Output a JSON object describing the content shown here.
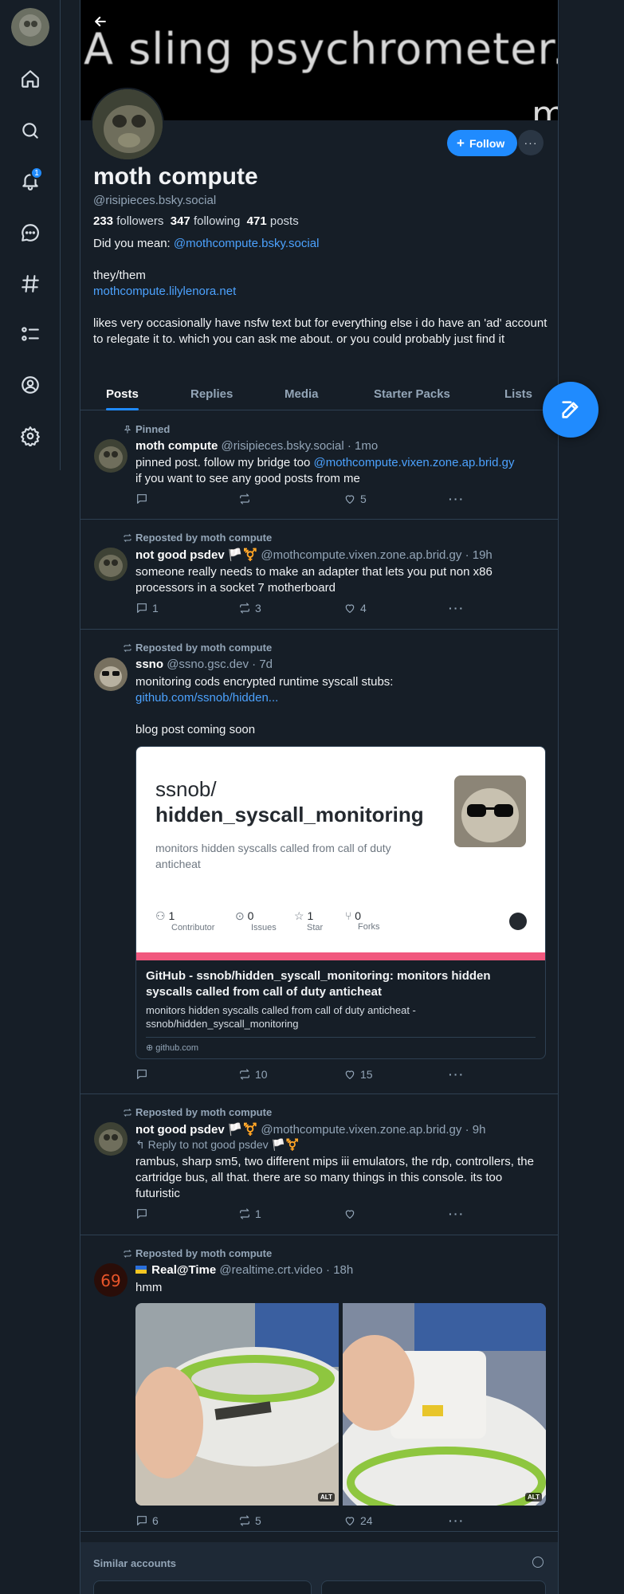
{
  "banner": {
    "text": "A sling psychrometer.",
    "text_fragment": "m"
  },
  "rail": {
    "notifications_count": "1"
  },
  "profile": {
    "display_name": "moth compute",
    "handle": "@risipieces.bsky.social",
    "followers_count": "233",
    "followers_label": "followers",
    "following_count": "347",
    "following_label": "following",
    "posts_count": "471",
    "posts_label": "posts",
    "follow_label": "Follow",
    "bio_did_you_mean": "Did you mean:",
    "bio_did_you_mean_link": "@mothcompute.bsky.social",
    "bio_pronouns": "they/them",
    "bio_site": "mothcompute.lilylenora.net",
    "bio_text": "likes very occasionally have nsfw text but for everything else i do have an 'ad' account to relegate it to. which you can ask me about. or you could probably just find it"
  },
  "tabs": [
    "Posts",
    "Replies",
    "Media",
    "Starter Packs",
    "Lists"
  ],
  "posts": [
    {
      "context": "Pinned",
      "author": "moth compute",
      "handle": "@risipieces.bsky.social",
      "time": "1mo",
      "text_a": "pinned post. follow my bridge too ",
      "text_link": "@mothcompute.vixen.zone.ap.brid.gy",
      "text_b": "if you want to see any good posts from me",
      "replies": "",
      "reposts": "",
      "likes": "5"
    },
    {
      "context": "Reposted by moth compute",
      "author": "not good psdev 🏳️⚧️",
      "handle": "@mothcompute.vixen.zone.ap.brid.gy",
      "time": "19h",
      "text": "someone really needs to make an adapter that lets you put non x86 processors in a socket 7 motherboard",
      "replies": "1",
      "reposts": "3",
      "likes": "4"
    },
    {
      "context": "Reposted by moth compute",
      "author": "ssno",
      "handle": "@ssno.gsc.dev",
      "time": "7d",
      "text": "monitoring cods encrypted runtime syscall stubs:",
      "link": "github.com/ssnob/hidden...",
      "text2": "blog post coming soon",
      "card": {
        "repo_owner": "ssnob/",
        "repo_name": "hidden_syscall_monitoring",
        "repo_desc": "monitors hidden syscalls called from call of duty anticheat",
        "stats": [
          {
            "value": "1",
            "label": "Contributor"
          },
          {
            "value": "0",
            "label": "Issues"
          },
          {
            "value": "1",
            "label": "Star"
          },
          {
            "value": "0",
            "label": "Forks"
          }
        ],
        "title": "GitHub - ssnob/hidden_syscall_monitoring: monitors hidden syscalls called from call of duty anticheat",
        "description": "monitors hidden syscalls called from call of duty anticheat - ssnob/hidden_syscall_monitoring",
        "domain": "github.com"
      },
      "replies": "",
      "reposts": "10",
      "likes": "15"
    },
    {
      "context": "Reposted by moth compute",
      "author": "not good psdev 🏳️⚧️",
      "handle": "@mothcompute.vixen.zone.ap.brid.gy",
      "time": "9h",
      "reply_to": "Reply to not good psdev 🏳️⚧️",
      "text": "rambus, sharp sm5, two different mips iii emulators, the rdp, controllers, the cartridge bus, all that. there are so many things in this console. its too futuristic",
      "replies": "",
      "reposts": "1",
      "likes": ""
    },
    {
      "context": "Reposted by moth compute",
      "author": "Real@Time",
      "handle": "@realtime.crt.video",
      "time": "18h",
      "text": "hmm",
      "alt1": "ALT",
      "alt2": "ALT",
      "replies": "6",
      "reposts": "5",
      "likes": "24"
    }
  ],
  "similar_accounts": {
    "title": "Similar accounts"
  },
  "colors": {
    "accent": "#208bfe",
    "background": "#161e27",
    "border": "#2e4052",
    "muted": "#93a5b7",
    "link": "#4ca2fe"
  }
}
